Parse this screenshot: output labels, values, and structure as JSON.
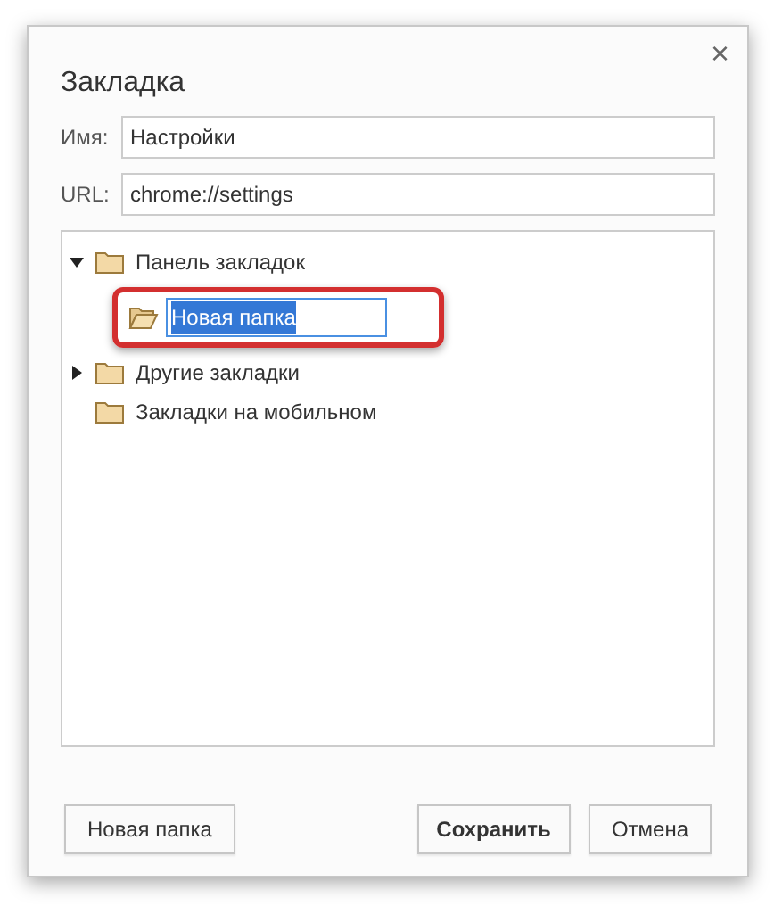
{
  "dialog": {
    "title": "Закладка",
    "close": "×"
  },
  "fields": [
    {
      "label": "Имя:",
      "value": "Настройки"
    },
    {
      "label": "URL:",
      "value": "chrome://settings"
    }
  ],
  "tree": [
    {
      "label": "Панель закладок",
      "expanded": true,
      "children": [
        {
          "kind": "editing",
          "value": "Новая папка",
          "selected": true
        }
      ]
    },
    {
      "label": "Другие закладки",
      "expanded": false
    },
    {
      "label": "Закладки на мобильном"
    }
  ],
  "buttons": [
    {
      "label": "Новая папка",
      "kind": "secondary"
    },
    {
      "label": "Сохранить",
      "kind": "primary"
    },
    {
      "label": "Отмена",
      "kind": "secondary"
    }
  ]
}
